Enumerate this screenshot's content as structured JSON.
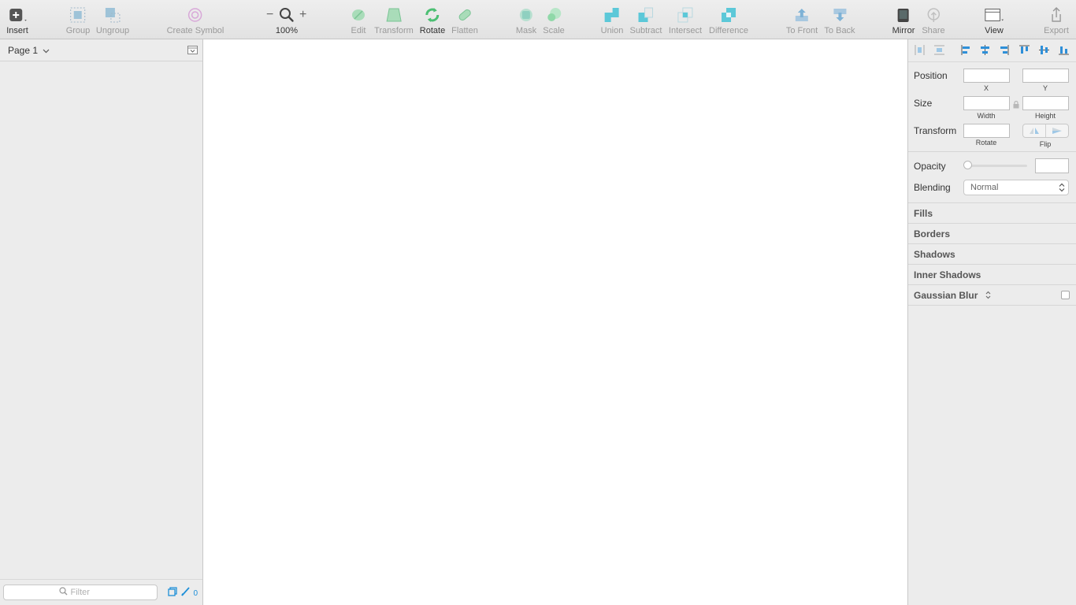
{
  "toolbar": {
    "insert": "Insert",
    "group": "Group",
    "ungroup": "Ungroup",
    "create_symbol": "Create Symbol",
    "zoom_minus": "−",
    "zoom_plus": "+",
    "zoom": "100%",
    "edit": "Edit",
    "transform": "Transform",
    "rotate": "Rotate",
    "flatten": "Flatten",
    "mask": "Mask",
    "scale": "Scale",
    "union": "Union",
    "subtract": "Subtract",
    "intersect": "Intersect",
    "difference": "Difference",
    "to_front": "To Front",
    "to_back": "To Back",
    "mirror": "Mirror",
    "share": "Share",
    "view": "View",
    "export": "Export"
  },
  "sidebar": {
    "page": "Page 1",
    "filter_placeholder": "Filter",
    "count": "0"
  },
  "inspector": {
    "position": "Position",
    "x": "X",
    "y": "Y",
    "size": "Size",
    "width": "Width",
    "height": "Height",
    "transform": "Transform",
    "rotate": "Rotate",
    "flip": "Flip",
    "opacity": "Opacity",
    "opacity_level": 0,
    "blending": "Blending",
    "blending_value": "Normal",
    "fills": "Fills",
    "borders": "Borders",
    "shadows": "Shadows",
    "inner_shadows": "Inner Shadows",
    "gaussian_blur": "Gaussian Blur"
  },
  "colors": {
    "accent": "#1e8fd8",
    "cyan_icon": "#5cc8d8",
    "green_icon": "#5fcf88"
  }
}
